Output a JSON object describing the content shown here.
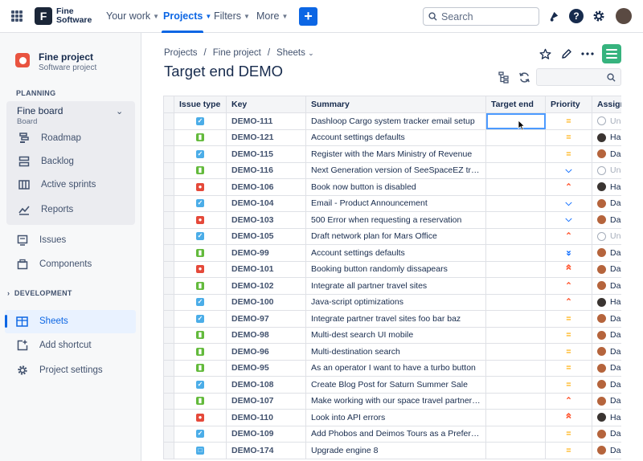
{
  "nav": {
    "logo_line1": "Fine",
    "logo_line2": "Software",
    "your_work": "Your work",
    "projects": "Projects",
    "filters": "Filters",
    "more": "More",
    "create": "+",
    "search_placeholder": "Search",
    "accent": "#0c66e4"
  },
  "sidebar": {
    "project_name": "Fine project",
    "project_type": "Software project",
    "planning_label": "PLANNING",
    "board_name": "Fine board",
    "board_sub": "Board",
    "items": [
      {
        "label": "Roadmap",
        "icon": "roadmap-icon"
      },
      {
        "label": "Backlog",
        "icon": "backlog-icon"
      },
      {
        "label": "Active sprints",
        "icon": "sprints-icon"
      },
      {
        "label": "Reports",
        "icon": "reports-icon"
      },
      {
        "label": "Issues",
        "icon": "issues-icon"
      },
      {
        "label": "Components",
        "icon": "components-icon"
      }
    ],
    "development_label": "DEVELOPMENT",
    "sheets": "Sheets",
    "add_shortcut": "Add shortcut",
    "project_settings": "Project settings"
  },
  "main": {
    "breadcrumb": [
      "Projects",
      "/",
      "Fine project",
      "/",
      "Sheets"
    ],
    "title": "Target end DEMO"
  },
  "table": {
    "headers": [
      "Issue type",
      "Key",
      "Summary",
      "Target end",
      "Priority",
      "Assignee"
    ],
    "rows": [
      {
        "type": "task",
        "key": "DEMO-111",
        "summary": "Dashloop Cargo system tracker email setup",
        "target": "",
        "priority": "medium",
        "assignee": "Una"
      },
      {
        "type": "story",
        "key": "DEMO-121",
        "summary": "Account settings defaults",
        "target": "",
        "priority": "medium",
        "assignee": "Har"
      },
      {
        "type": "task",
        "key": "DEMO-115",
        "summary": "Register with the Mars Ministry of Revenue",
        "target": "",
        "priority": "medium",
        "assignee": "Dar"
      },
      {
        "type": "story",
        "key": "DEMO-116",
        "summary": "Next Generation version of SeeSpaceEZ travel...",
        "target": "",
        "priority": "low",
        "assignee": "Una"
      },
      {
        "type": "bug",
        "key": "DEMO-106",
        "summary": "Book now button is disabled",
        "target": "",
        "priority": "high",
        "assignee": "Har"
      },
      {
        "type": "task",
        "key": "DEMO-104",
        "summary": "Email - Product Announcement",
        "target": "",
        "priority": "low",
        "assignee": "Dar"
      },
      {
        "type": "bug",
        "key": "DEMO-103",
        "summary": "500 Error when requesting a reservation",
        "target": "",
        "priority": "low",
        "assignee": "Dar"
      },
      {
        "type": "task",
        "key": "DEMO-105",
        "summary": "Draft network plan for Mars Office",
        "target": "",
        "priority": "high",
        "assignee": "Una"
      },
      {
        "type": "story",
        "key": "DEMO-99",
        "summary": "Account settings defaults",
        "target": "",
        "priority": "lowest",
        "assignee": "Dar"
      },
      {
        "type": "bug",
        "key": "DEMO-101",
        "summary": "Booking button randomly dissapears",
        "target": "",
        "priority": "highest",
        "assignee": "Dar"
      },
      {
        "type": "story",
        "key": "DEMO-102",
        "summary": "Integrate all partner travel sites",
        "target": "",
        "priority": "high",
        "assignee": "Dar"
      },
      {
        "type": "task",
        "key": "DEMO-100",
        "summary": "Java-script optimizations",
        "target": "",
        "priority": "high",
        "assignee": "Har"
      },
      {
        "type": "task",
        "key": "DEMO-97",
        "summary": "Integrate partner travel sites foo bar baz",
        "target": "",
        "priority": "medium",
        "assignee": "Dar"
      },
      {
        "type": "story",
        "key": "DEMO-98",
        "summary": "Multi-dest search UI mobile",
        "target": "",
        "priority": "medium",
        "assignee": "Dar"
      },
      {
        "type": "story",
        "key": "DEMO-96",
        "summary": "Multi-destination search",
        "target": "",
        "priority": "medium",
        "assignee": "Dar"
      },
      {
        "type": "story",
        "key": "DEMO-95",
        "summary": "As an operator I want to have a turbo button",
        "target": "",
        "priority": "medium",
        "assignee": "Dar"
      },
      {
        "type": "task",
        "key": "DEMO-108",
        "summary": "Create Blog Post for Saturn Summer Sale",
        "target": "",
        "priority": "medium",
        "assignee": "Dar"
      },
      {
        "type": "story",
        "key": "DEMO-107",
        "summary": "Make working with our space travel partners e...",
        "target": "",
        "priority": "high",
        "assignee": "Dar"
      },
      {
        "type": "bug",
        "key": "DEMO-110",
        "summary": "Look into API errors",
        "target": "",
        "priority": "highest",
        "assignee": "Har"
      },
      {
        "type": "task",
        "key": "DEMO-109",
        "summary": "Add Phobos and Deimos Tours as a Preferred ...",
        "target": "",
        "priority": "medium",
        "assignee": "Dar"
      },
      {
        "type": "subtask",
        "key": "DEMO-174",
        "summary": "Upgrade engine 8",
        "target": "",
        "priority": "medium",
        "assignee": "Dar"
      }
    ]
  },
  "colors": {
    "task": "#4bade8",
    "story": "#63ba3c",
    "bug": "#e5493a",
    "subtask": "#4bade8",
    "medium": "#ffab00",
    "low": "#0065ff",
    "lowest": "#0065ff",
    "high": "#ff5630",
    "highest": "#ff5630"
  }
}
